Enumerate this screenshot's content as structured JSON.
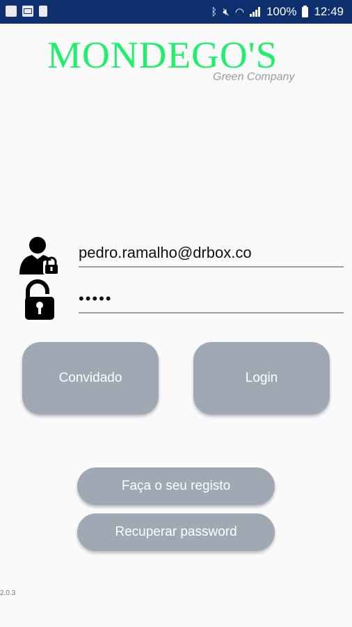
{
  "status_bar": {
    "battery": "100%",
    "time": "12:49",
    "icons": [
      "outlook-icon",
      "mail-icon",
      "sim-card-icon",
      "bluetooth-icon",
      "mute-icon",
      "wifi-icon",
      "signal-icon",
      "battery-icon"
    ]
  },
  "logo": {
    "title": "MONDEGO'S",
    "subtitle": "Green Company",
    "color": "#1ef06a"
  },
  "form": {
    "username_value": "pedro.ramalho@drbox.co",
    "password_value": "•••••"
  },
  "buttons": {
    "guest": "Convidado",
    "login": "Login",
    "register": "Faça o seu registo",
    "recover": "Recuperar password"
  },
  "version": "2.0.3",
  "colors": {
    "status_bar": "#0d2f6e",
    "button": "#9fa9b3",
    "background": "#fafafa"
  }
}
